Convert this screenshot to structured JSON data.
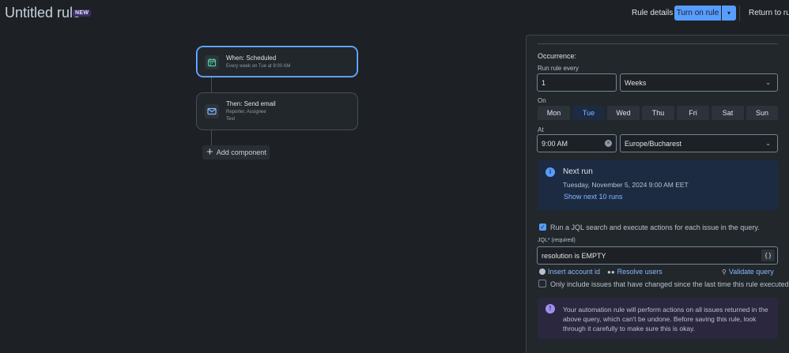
{
  "header": {
    "title": "Untitled rule",
    "badge": "NEW",
    "rule_details": "Rule details",
    "turn_on": "Turn on rule",
    "return": "Return to rule"
  },
  "canvas": {
    "trigger": {
      "title": "When: Scheduled",
      "subtitle": "Every week on Tue at 9:00 AM"
    },
    "action": {
      "title": "Then: Send email",
      "line1": "Reporter, Assignee",
      "line2": "Test"
    },
    "add_component": "Add component"
  },
  "panel": {
    "occurrence_label": "Occurrence:",
    "run_every_label": "Run rule every",
    "run_every_value": "1",
    "period_value": "Weeks",
    "on_label": "On",
    "days": [
      "Mon",
      "Tue",
      "Wed",
      "Thu",
      "Fri",
      "Sat",
      "Sun"
    ],
    "selected_day": "Tue",
    "at_label": "At",
    "time_value": "9:00 AM",
    "timezone_value": "Europe/Bucharest",
    "next_run": {
      "title": "Next run",
      "date": "Tuesday, November 5, 2024 9:00 AM EET",
      "link": "Show next 10 runs"
    },
    "jql_checkbox": {
      "checked": true,
      "label": "Run a JQL search and execute actions for each issue in the query."
    },
    "jql_label": "JQL*",
    "jql_required": "(required)",
    "jql_value": "resolution is EMPTY",
    "jql_braces": "{ }",
    "insert_account": "Insert account id",
    "resolve_users": "Resolve users",
    "validate_query": "Validate query",
    "changed_checkbox": {
      "checked": false,
      "label": "Only include issues that have changed since the last time this rule executed"
    },
    "warning": "Your automation rule will perform actions on all issues returned in the above query, which can't be undone. Before saving this rule, look through it carefully to make sure this is okay."
  },
  "colors": {
    "primary": "#579dff",
    "info_bg": "#1c2b41",
    "discovery_bg": "#2b273f",
    "link": "#85b8ff"
  }
}
